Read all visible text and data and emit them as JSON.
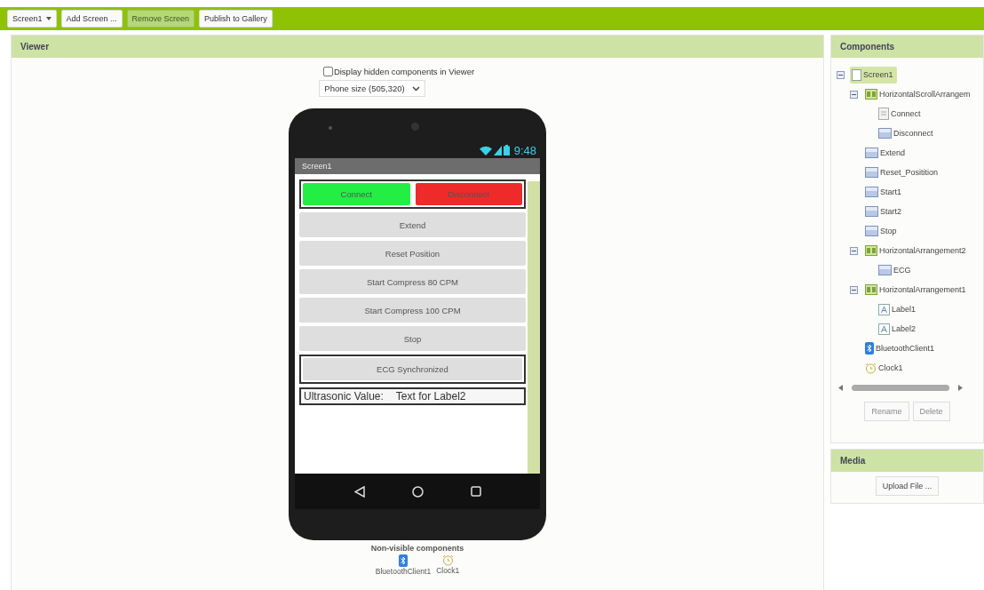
{
  "toolbar": {
    "buttons": [
      {
        "label": "Screen1",
        "kind": "dropdown",
        "disabled": false
      },
      {
        "label": "Add Screen ...",
        "kind": "plain",
        "disabled": false
      },
      {
        "label": "Remove Screen",
        "kind": "plain",
        "disabled": true
      },
      {
        "label": "Publish to Gallery",
        "kind": "plain",
        "disabled": false
      }
    ]
  },
  "viewer": {
    "title": "Viewer",
    "hidden_checkbox": {
      "label": "Display hidden components in Viewer",
      "checked": false
    },
    "phone_size": "Phone size (505,320)",
    "phone": {
      "time": "9:48",
      "screen_title": "Screen1",
      "components": [
        {
          "kind": "row",
          "items": [
            {
              "label": "Connect",
              "color": "#22ee44"
            },
            {
              "label": "Disconnect",
              "color": "#ee2a2a"
            }
          ]
        },
        {
          "kind": "button",
          "label": "Extend"
        },
        {
          "kind": "button",
          "label": "Reset Position"
        },
        {
          "kind": "button",
          "label": "Start Compress 80 CPM"
        },
        {
          "kind": "button",
          "label": "Start Compress 100 CPM"
        },
        {
          "kind": "button",
          "label": "Stop"
        },
        {
          "kind": "row",
          "items": [
            {
              "label": "ECG Synchronized"
            }
          ]
        },
        {
          "kind": "labels",
          "items": [
            "Ultrasonic Value:",
            "Text for Label2"
          ]
        }
      ]
    },
    "non_visible": {
      "title": "Non-visible components",
      "items": [
        {
          "label": "BluetoothClient1",
          "kind": "bluetooth"
        },
        {
          "label": "Clock1",
          "kind": "clock"
        }
      ]
    }
  },
  "components": {
    "title": "Components",
    "tree": [
      {
        "label": "Screen1",
        "kind": "screen",
        "selected": true,
        "expanded": true,
        "children": [
          {
            "label": "HorizontalScrollArrangem",
            "kind": "arrangement",
            "selected": false,
            "expanded": true,
            "children": [
              {
                "label": "Connect",
                "kind": "button-plain",
                "selected": false
              },
              {
                "label": "Disconnect",
                "kind": "button",
                "selected": false
              }
            ]
          },
          {
            "label": "Extend",
            "kind": "button",
            "selected": false
          },
          {
            "label": "Reset_Positition",
            "kind": "button",
            "selected": false
          },
          {
            "label": "Start1",
            "kind": "button",
            "selected": false
          },
          {
            "label": "Start2",
            "kind": "button",
            "selected": false
          },
          {
            "label": "Stop",
            "kind": "button",
            "selected": false
          },
          {
            "label": "HorizontalArrangement2",
            "kind": "arrangement",
            "selected": false,
            "expanded": true,
            "children": [
              {
                "label": "ECG",
                "kind": "button",
                "selected": false
              }
            ]
          },
          {
            "label": "HorizontalArrangement1",
            "kind": "arrangement",
            "selected": false,
            "expanded": true,
            "children": [
              {
                "label": "Label1",
                "kind": "label",
                "selected": false
              },
              {
                "label": "Label2",
                "kind": "label",
                "selected": false
              }
            ]
          },
          {
            "label": "BluetoothClient1",
            "kind": "bluetooth",
            "selected": false
          },
          {
            "label": "Clock1",
            "kind": "clock",
            "selected": false
          }
        ]
      }
    ],
    "buttons": [
      {
        "label": "Rename",
        "disabled": true
      },
      {
        "label": "Delete",
        "disabled": true
      }
    ]
  },
  "media": {
    "title": "Media",
    "upload_button": "Upload File ..."
  }
}
